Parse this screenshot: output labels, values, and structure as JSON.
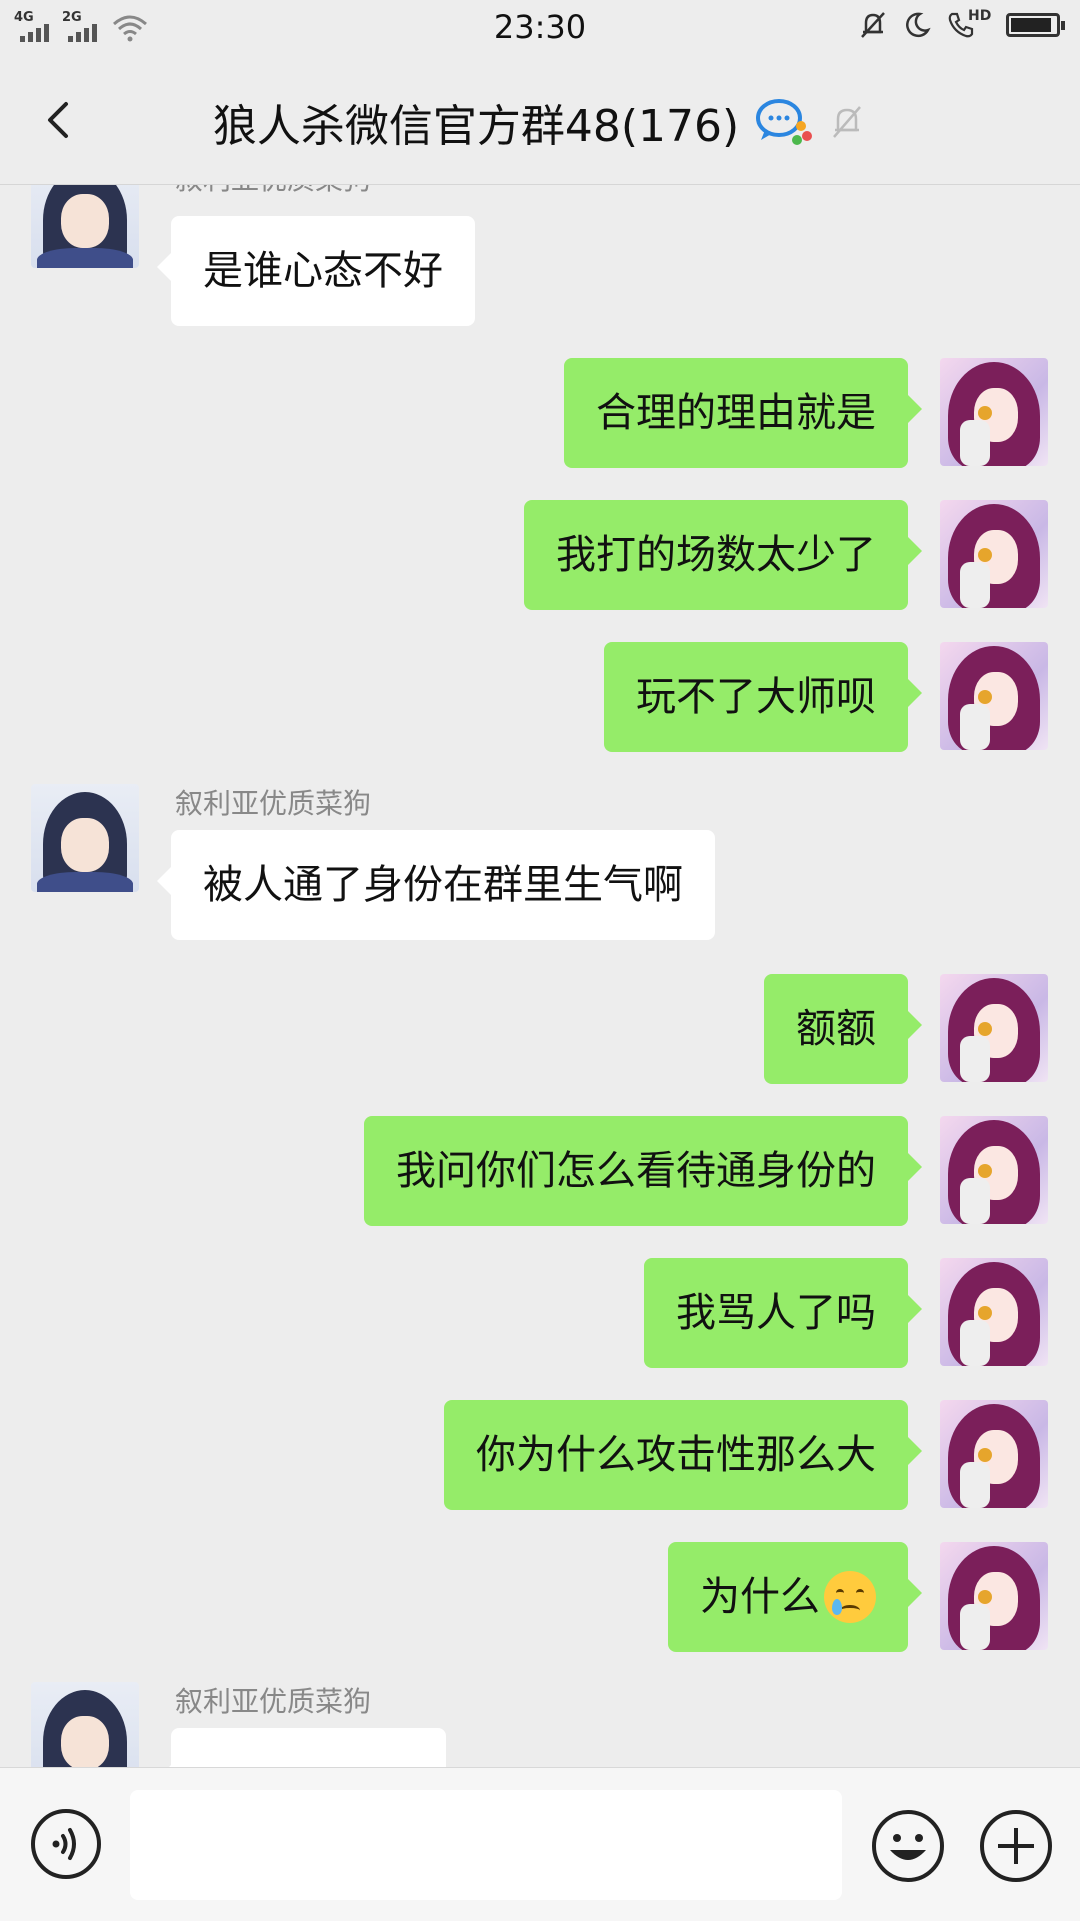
{
  "status_bar": {
    "time": "23:30",
    "signal1_label": "4G",
    "signal2_label": "2G",
    "hd_label": "HD",
    "battery_level": 0.92
  },
  "header": {
    "title": "狼人杀微信官方群48(176)"
  },
  "messages": [
    {
      "side": "in",
      "sender": "叙利亚优质菜狗",
      "text": "是谁心态不好"
    },
    {
      "side": "out",
      "text": "合理的理由就是"
    },
    {
      "side": "out",
      "text": "我打的场数太少了"
    },
    {
      "side": "out",
      "text": "玩不了大师呗"
    },
    {
      "side": "in",
      "sender": "叙利亚优质菜狗",
      "text": "被人通了身份在群里生气啊"
    },
    {
      "side": "out",
      "text": "额额"
    },
    {
      "side": "out",
      "text": "我问你们怎么看待通身份的"
    },
    {
      "side": "out",
      "text": "我骂人了吗"
    },
    {
      "side": "out",
      "text": "你为什么攻击性那么大"
    },
    {
      "side": "out",
      "text": "为什么",
      "emoji": "crying-face"
    },
    {
      "side": "in",
      "sender": "叙利亚优质菜狗",
      "text": ""
    }
  ],
  "colors": {
    "outgoing_bubble": "#95ec69",
    "incoming_bubble": "#ffffff",
    "background": "#ededed"
  }
}
